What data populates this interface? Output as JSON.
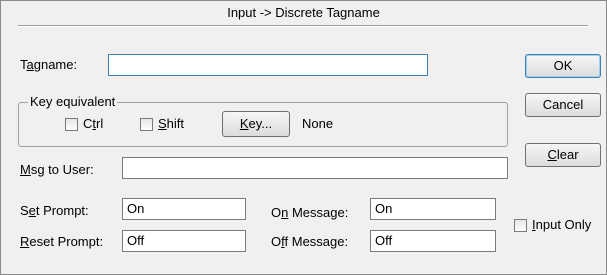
{
  "window": {
    "title": "Input -> Discrete Tagname"
  },
  "tagname": {
    "label": "Tagname:",
    "value": ""
  },
  "key_group": {
    "legend": "Key equivalent",
    "ctrl_label": "Ctrl",
    "shift_label": "Shift",
    "key_button": "Key...",
    "key_value": "None"
  },
  "msg_to_user": {
    "label": "Msg to User:",
    "value": ""
  },
  "set_prompt": {
    "label": "Set Prompt:",
    "value": "On"
  },
  "reset_prompt": {
    "label": "Reset Prompt:",
    "value": "Off"
  },
  "on_message": {
    "label": "On Message:",
    "value": "On"
  },
  "off_message": {
    "label": "Off Message:",
    "value": "Off"
  },
  "input_only": {
    "label": "Input Only",
    "checked": false
  },
  "buttons": {
    "ok": "OK",
    "cancel": "Cancel",
    "clear": "Clear"
  }
}
